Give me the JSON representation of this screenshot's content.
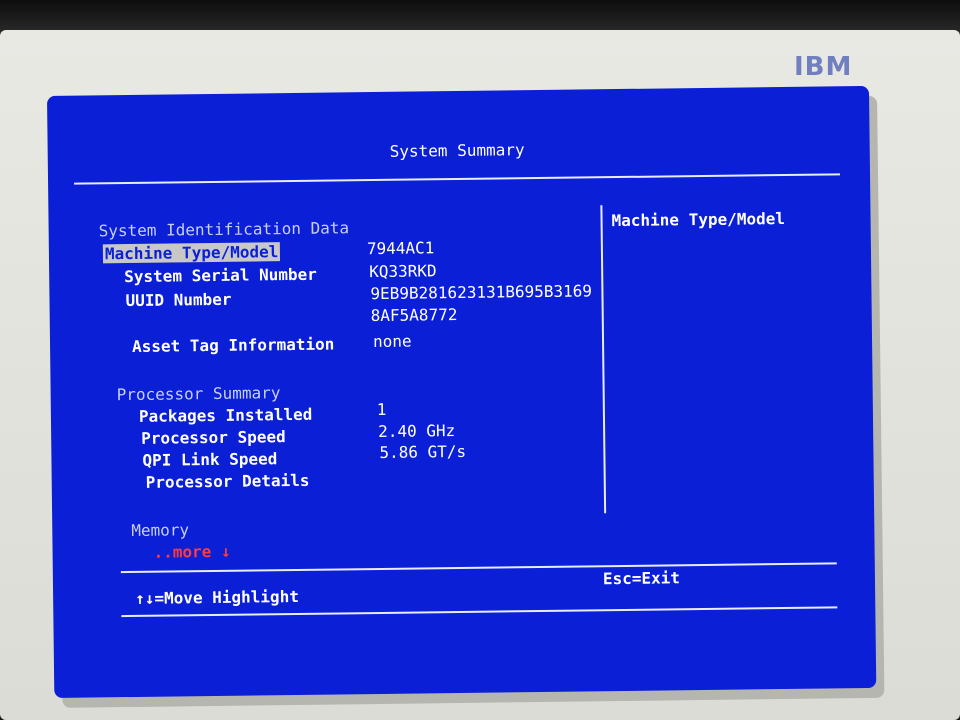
{
  "brand": "IBM",
  "title": "System Summary",
  "sections": {
    "identification": {
      "heading": "System Identification Data",
      "machine_type_label": "Machine Type/Model",
      "machine_type_value": "7944AC1",
      "serial_label": "System Serial Number",
      "serial_value": "KQ33RKD",
      "uuid_label": "UUID Number",
      "uuid_value_line1": "9EB9B281623131B695B3169",
      "uuid_value_line2": "8AF5A8772",
      "asset_label": "Asset Tag Information",
      "asset_value": "none"
    },
    "processor": {
      "heading": "Processor Summary",
      "packages_label": "Packages Installed",
      "packages_value": "1",
      "speed_label": "Processor Speed",
      "speed_value": "2.40 GHz",
      "qpi_label": "QPI Link Speed",
      "qpi_value": "5.86 GT/s",
      "details_label": "Processor Details"
    },
    "memory": {
      "heading": "Memory",
      "more": "..more ↓"
    }
  },
  "help_panel": {
    "text": "Machine Type/Model"
  },
  "footer": {
    "move_hint": "↑↓=Move Highlight",
    "exit_hint": "Esc=Exit"
  }
}
